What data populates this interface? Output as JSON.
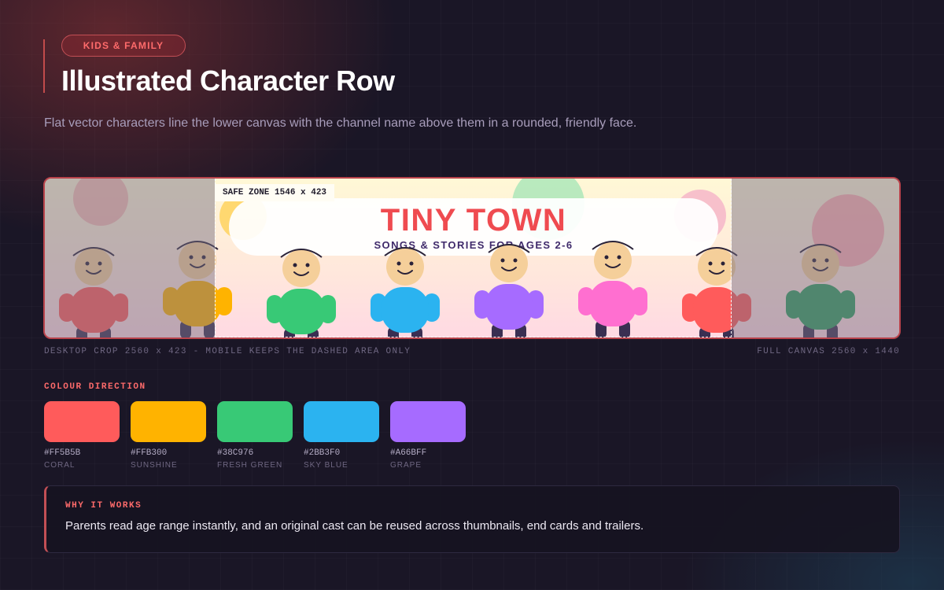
{
  "header": {
    "tag": "KIDS & FAMILY",
    "title": "Illustrated Character Row",
    "subtitle": "Flat vector characters line the lower canvas with the channel name above them in a rounded, friendly face."
  },
  "banner": {
    "safe_zone_label": "SAFE ZONE 1546 x 423",
    "channel_name": "TINY TOWN",
    "tagline": "SONGS & STORIES FOR AGES 2-6",
    "characters": [
      {
        "color": "#FF5B5B"
      },
      {
        "color": "#FFB300"
      },
      {
        "color": "#38C976"
      },
      {
        "color": "#2BB3F0"
      },
      {
        "color": "#A66BFF"
      },
      {
        "color": "#FF6FD0"
      },
      {
        "color": "#FF5B5B"
      },
      {
        "color": "#2E9E5F"
      }
    ],
    "skin_color": "#F5CF9A",
    "leg_color": "#3A2F52"
  },
  "notes": {
    "crop": "DESKTOP CROP 2560 x 423 - MOBILE KEEPS THE DASHED AREA ONLY",
    "canvas": "FULL CANVAS 2560 x 1440"
  },
  "palette": {
    "heading": "COLOUR DIRECTION",
    "swatches": [
      {
        "hex": "#FF5B5B",
        "name": "CORAL"
      },
      {
        "hex": "#FFB300",
        "name": "SUNSHINE"
      },
      {
        "hex": "#38C976",
        "name": "FRESH GREEN"
      },
      {
        "hex": "#2BB3F0",
        "name": "SKY BLUE"
      },
      {
        "hex": "#A66BFF",
        "name": "GRAPE"
      }
    ]
  },
  "why": {
    "heading": "WHY IT WORKS",
    "body": "Parents read age range instantly, and an original cast can be reused across thumbnails, end cards and trailers."
  },
  "colors": {
    "accent": "#FF6B6B",
    "background": "#1A1626"
  }
}
